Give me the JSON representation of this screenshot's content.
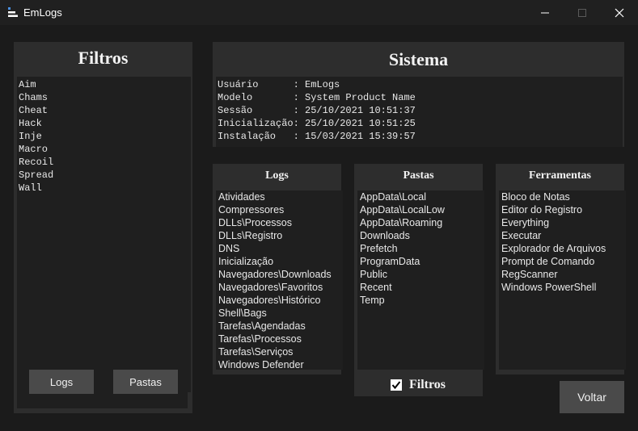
{
  "window": {
    "title": "EmLogs",
    "icon": "app-list-icon",
    "controls": [
      "minimize",
      "maximize",
      "close"
    ]
  },
  "filtros": {
    "title": "Filtros",
    "items": [
      "Aim",
      "Chams",
      "Cheat",
      "Hack",
      "Inje",
      "Macro",
      "Recoil",
      "Spread",
      "Wall"
    ],
    "logs_button": "Logs",
    "pastas_button": "Pastas"
  },
  "sistema": {
    "title": "Sistema",
    "rows": [
      {
        "key": "Usuário      ",
        "value": ": EmLogs"
      },
      {
        "key": "Modelo       ",
        "value": ": System Product Name"
      },
      {
        "key": "Sessão       ",
        "value": ": 25/10/2021 10:51:37"
      },
      {
        "key": "Inicialização",
        "value": ": 25/10/2021 10:51:25"
      },
      {
        "key": "Instalação   ",
        "value": ": 15/03/2021 15:39:57"
      }
    ]
  },
  "logs": {
    "title": "Logs",
    "items": [
      "Atividades",
      "Compressores",
      "DLLs\\Processos",
      "DLLs\\Registro",
      "DNS",
      "Inicialização",
      "Navegadores\\Downloads",
      "Navegadores\\Favoritos",
      "Navegadores\\Histórico",
      "Shell\\Bags",
      "Tarefas\\Agendadas",
      "Tarefas\\Processos",
      "Tarefas\\Serviços",
      "Windows Defender"
    ]
  },
  "pastas": {
    "title": "Pastas",
    "items": [
      "AppData\\Local",
      "AppData\\LocalLow",
      "AppData\\Roaming",
      "Downloads",
      "Prefetch",
      "ProgramData",
      "Public",
      "Recent",
      "Temp"
    ],
    "checkbox_label": "Filtros",
    "checkbox_checked": true
  },
  "ferramentas": {
    "title": "Ferramentas",
    "items": [
      "Bloco de Notas",
      "Editor do Registro",
      "Everything",
      "Executar",
      "Explorador de Arquivos",
      "Prompt de Comando",
      "RegScanner",
      "Windows PowerShell"
    ]
  },
  "voltar_button": "Voltar"
}
